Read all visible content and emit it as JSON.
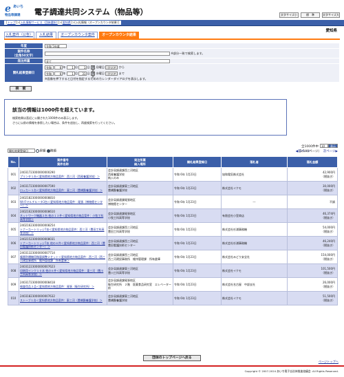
{
  "header": {
    "logo_mark": "e",
    "logo_top": "あいち",
    "logo_sub": "物品等調達",
    "title": "電子調達共同システム（物品等）",
    "font_buttons": [
      "文字サイズ小",
      "標　準",
      "文字サイズ大"
    ]
  },
  "breadcrumb": {
    "items": [
      "トップ",
      "入札情報サービス（団体選択）",
      "愛知県"
    ],
    "current": "入札情報（オープンカウンタ結果）"
  },
  "prefecture": "愛知県",
  "tabs": [
    "入札案件（公告）",
    "入札結果",
    "オープンカウンタ案件",
    "オープンカウンタ結果"
  ],
  "form": {
    "year_label": "年度",
    "year_value": "令和 5年度",
    "name_label": "案件名称",
    "name_sub": "（全角50文字）",
    "name_note": "※部分一致で検索します。",
    "dept_label": "発注所属",
    "dept_value": "全て",
    "date_label": "開札結果登録日",
    "era": "令和",
    "from": {
      "year": "6",
      "month": "1",
      "day": "1",
      "weekday": "月",
      "suffix": "から"
    },
    "to": {
      "year": "6",
      "month": "1",
      "day": "31",
      "weekday": "水",
      "suffix": "まで"
    },
    "year_unit": "年",
    "month_unit": "月",
    "day_unit": "日",
    "weekday_unit": "曜日",
    "cal_label": "選択",
    "clear_label": "クリア",
    "cal_note": "※画像を押下すると日付を指定するためのカレンダーダイアログを表示します。",
    "search_button": "検　索"
  },
  "message": {
    "title": "該当の情報は1000件を超えています。",
    "lines": [
      "検索結果は直近に公開された1000件のみ表示します。",
      "さらに以前の情報を参照したい場合は、条件を追加し、再度検索を行ってください。"
    ]
  },
  "sort": {
    "field": "開札結果登録日",
    "asc": "昇順",
    "desc": "降順",
    "count": "全1000件中",
    "per_page": "10",
    "go": "表示",
    "prev": "前ページ",
    "page_info": "（1/100ページ）",
    "next": "次ページ"
  },
  "table": {
    "headers": [
      "No.",
      "案件番号\n案件名称",
      "発注所属\n納入場所",
      "開札結果登録日",
      "落札者",
      "落札金額"
    ],
    "rows": [
      {
        "no": "001",
        "id": "24031723000000000290",
        "name": "プリンタ１台＜愛知県地方物品案件：西三河（西尾養護学校）＞",
        "dept": "会計局調達課西三河地区",
        "place": "西尾養護学校\n納入のみ",
        "date": "令和 6年 1月23日",
        "winner": "協和電気株式会社",
        "amount": "42,900円",
        "note": "（税抜き）"
      },
      {
        "no": "002",
        "id": "24031723000000007590",
        "name": "ロッカー１台＜愛知県地方物品案件：東三河（豊橋聾養護学校）＞",
        "dept": "会計局調達課東三河地区",
        "place": "豊橋聾養護学校",
        "date": "令和 6年 1月23日",
        "winner": "株式会社イクモ",
        "amount": "30,000円",
        "note": "（税抜き）"
      },
      {
        "no": "003",
        "id": "24021823000000008810",
        "name": "Wi-Fiマルチルータ3台＜愛知県地方物品案件：尾張（博物館センター）＞",
        "dept": "会計局調達課尾張地区",
        "place": "博物館センター",
        "date": "令和 6年 1月23日",
        "winner": "---",
        "amount": "不調",
        "note": ""
      },
      {
        "no": "004",
        "id": "24021623000000008610",
        "name": "ネットワーク機器２台 他の１３件＜愛知県地方物品案件：小牧工科高等学校＞",
        "dept": "会計局調達課尾張地区",
        "place": "小牧工科高等学校",
        "date": "令和 6年 1月23日",
        "winner": "有限会社小室商店",
        "amount": "46,374円",
        "note": "（税抜き）"
      },
      {
        "no": "005",
        "id": "24021623000000008254",
        "name": "トナーカートリッジ7本＜愛知県地方物品案件：西三河（豊田工科高等学校）＞",
        "dept": "会計局調達課西三河地区",
        "place": "豊田工科高等学校",
        "date": "令和 6年 1月23日",
        "winner": "株式会社杉浦事務機",
        "amount": "54,000円",
        "note": "（税抜き）"
      },
      {
        "no": "006",
        "id": "24021523000000008031",
        "name": "トナーカートリッジ7本 他の６件＜愛知県地方物品案件：西三河（豊田看護技術センター）＞",
        "dept": "会計局調達課西三河地区",
        "place": "豊田看護技術センター",
        "date": "令和 6年 1月23日",
        "winner": "株式会社杉浦事務機",
        "amount": "46,240円",
        "note": "（税抜き）"
      },
      {
        "no": "007",
        "id": "24031323000000007714",
        "name": "複層防爆機用微量調整２セット＜愛知県地方物品案件：西三河（西三河建設事務所　維持管理課　所有倉庫＞",
        "dept": "会計局調達課西三河地区",
        "place": "西三河建設事務所　維持管理課　所有倉庫",
        "date": "令和 6年 1月23日",
        "winner": "株式会社みどり安全社",
        "amount": "154,000円",
        "note": "（税抜き）"
      },
      {
        "no": "008",
        "id": "24031223000000007623",
        "name": "印刷用インク１０本 他の６件＜愛知県地方物品案件：東三河（豊川工科高等学校）＞",
        "dept": "会計局調達課東三河地区",
        "place": "豊川工科高等学校",
        "date": "令和 6年 1月23日",
        "winner": "株式会社イクモ",
        "amount": "101,500円",
        "note": "（税抜き）"
      },
      {
        "no": "009",
        "id": "24031723000000008418",
        "name": "検査用品２品＜愛知県地方物品案件：尾張（衛生研究所）＞",
        "dept": "会計局調達課尾張地区",
        "place": "衛生研究所　２階　医薬食品研究室　エレベーター前",
        "date": "令和 6年 1月23日",
        "winner": "株式会社名古屋　中部支社",
        "amount": "26,000円",
        "note": "（税抜き）"
      },
      {
        "no": "010",
        "id": "24031823000000007632",
        "name": "ストーブ１台＜愛知県地方物品案件：東三河（豊橋聾養護学校）＞",
        "dept": "会計局調達課東三河地区",
        "place": "豊橋聾養護学校",
        "date": "令和 6年 1月23日",
        "winner": "株式会社イクモ",
        "amount": "51,500円",
        "note": "（税抜き）"
      }
    ]
  },
  "footer": {
    "top_button": "団体のトップページへ戻る",
    "page_top": "ページトップへ",
    "copyright": "Copyright © 2007-2024 あいち電子自治体推進協議会. All Rights Reserved."
  },
  "colors": {
    "primary": "#3b5fa9",
    "accent": "#ff7a10",
    "footer_line": "#d42020",
    "row_alt": "#d8dcf2"
  }
}
